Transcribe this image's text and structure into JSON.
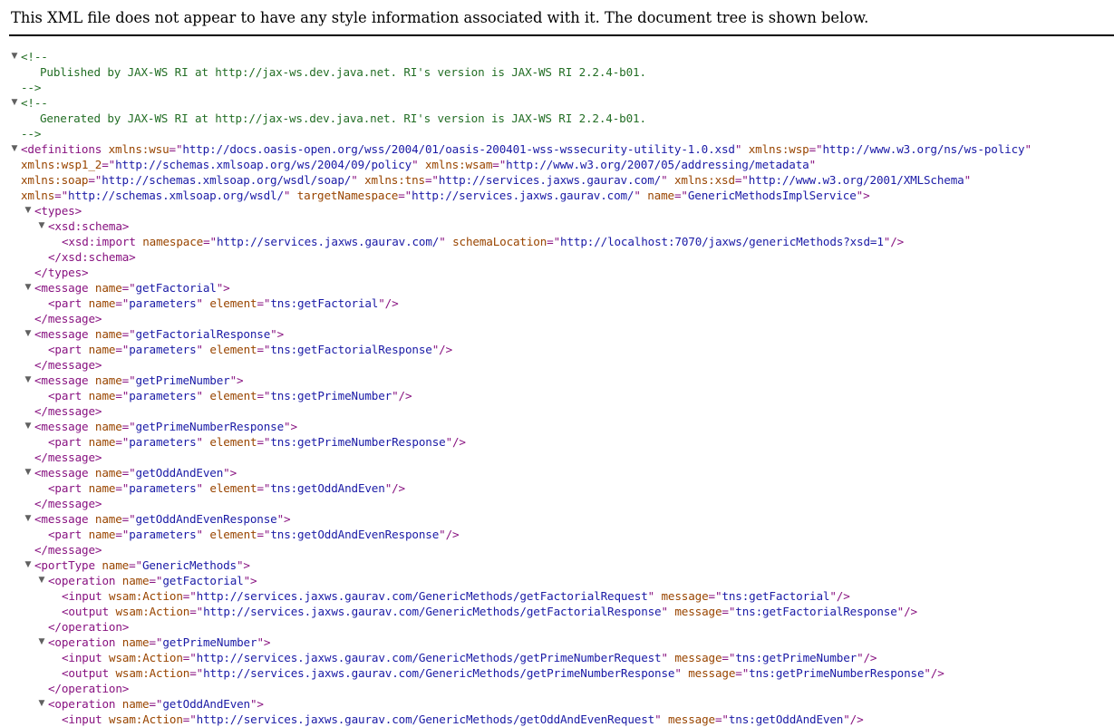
{
  "header": {
    "message": "This XML file does not appear to have any style information associated with it. The document tree is shown below."
  },
  "icons": {
    "toggle": "collapse-triangle-icon",
    "toggle_glyph": "▼"
  },
  "colors": {
    "tag": "#881280",
    "attribute_name": "#994500",
    "attribute_value": "#1a1aa6",
    "comment": "#236e25",
    "toggle": "#606060"
  },
  "lines": [
    {
      "d": 0,
      "toggle": true,
      "tokens": [
        [
          "c",
          "<!--"
        ]
      ]
    },
    {
      "d": 0,
      "x": 44,
      "tokens": [
        [
          "c",
          "Published by JAX-WS RI at http://jax-ws.dev.java.net. RI's version is JAX-WS RI 2.2.4-b01."
        ]
      ]
    },
    {
      "d": 0,
      "tokens": [
        [
          "c",
          "-->"
        ]
      ]
    },
    {
      "d": 0,
      "toggle": true,
      "tokens": [
        [
          "c",
          "<!--"
        ]
      ]
    },
    {
      "d": 0,
      "x": 44,
      "tokens": [
        [
          "c",
          "Generated by JAX-WS RI at http://jax-ws.dev.java.net. RI's version is JAX-WS RI 2.2.4-b01."
        ]
      ]
    },
    {
      "d": 0,
      "tokens": [
        [
          "c",
          "-->"
        ]
      ]
    },
    {
      "d": 0,
      "toggle": true,
      "tokens": [
        [
          "t",
          "<definitions"
        ],
        [
          "s",
          " "
        ],
        [
          "an",
          "xmlns:wsu"
        ],
        [
          "t",
          "=\""
        ],
        [
          "av",
          "http://docs.oasis-open.org/wss/2004/01/oasis-200401-wss-wssecurity-utility-1.0.xsd"
        ],
        [
          "t",
          "\""
        ],
        [
          "s",
          " "
        ],
        [
          "an",
          "xmlns:wsp"
        ],
        [
          "t",
          "=\""
        ],
        [
          "av",
          "http://www.w3.org/ns/ws-policy"
        ],
        [
          "t",
          "\""
        ]
      ]
    },
    {
      "d": 0,
      "tokens": [
        [
          "an",
          "xmlns:wsp1_2"
        ],
        [
          "t",
          "=\""
        ],
        [
          "av",
          "http://schemas.xmlsoap.org/ws/2004/09/policy"
        ],
        [
          "t",
          "\""
        ],
        [
          "s",
          " "
        ],
        [
          "an",
          "xmlns:wsam"
        ],
        [
          "t",
          "=\""
        ],
        [
          "av",
          "http://www.w3.org/2007/05/addressing/metadata"
        ],
        [
          "t",
          "\""
        ]
      ]
    },
    {
      "d": 0,
      "tokens": [
        [
          "an",
          "xmlns:soap"
        ],
        [
          "t",
          "=\""
        ],
        [
          "av",
          "http://schemas.xmlsoap.org/wsdl/soap/"
        ],
        [
          "t",
          "\""
        ],
        [
          "s",
          " "
        ],
        [
          "an",
          "xmlns:tns"
        ],
        [
          "t",
          "=\""
        ],
        [
          "av",
          "http://services.jaxws.gaurav.com/"
        ],
        [
          "t",
          "\""
        ],
        [
          "s",
          " "
        ],
        [
          "an",
          "xmlns:xsd"
        ],
        [
          "t",
          "=\""
        ],
        [
          "av",
          "http://www.w3.org/2001/XMLSchema"
        ],
        [
          "t",
          "\""
        ]
      ]
    },
    {
      "d": 0,
      "tokens": [
        [
          "an",
          "xmlns"
        ],
        [
          "t",
          "=\""
        ],
        [
          "av",
          "http://schemas.xmlsoap.org/wsdl/"
        ],
        [
          "t",
          "\""
        ],
        [
          "s",
          " "
        ],
        [
          "an",
          "targetNamespace"
        ],
        [
          "t",
          "=\""
        ],
        [
          "av",
          "http://services.jaxws.gaurav.com/"
        ],
        [
          "t",
          "\""
        ],
        [
          "s",
          " "
        ],
        [
          "an",
          "name"
        ],
        [
          "t",
          "=\""
        ],
        [
          "av",
          "GenericMethodsImplService"
        ],
        [
          "t",
          "\">"
        ]
      ]
    },
    {
      "d": 1,
      "toggle": true,
      "tokens": [
        [
          "t",
          "<types>"
        ]
      ]
    },
    {
      "d": 2,
      "toggle": true,
      "tokens": [
        [
          "t",
          "<xsd:schema>"
        ]
      ]
    },
    {
      "d": 3,
      "tokens": [
        [
          "t",
          "<xsd:import"
        ],
        [
          "s",
          " "
        ],
        [
          "an",
          "namespace"
        ],
        [
          "t",
          "=\""
        ],
        [
          "av",
          "http://services.jaxws.gaurav.com/"
        ],
        [
          "t",
          "\""
        ],
        [
          "s",
          " "
        ],
        [
          "an",
          "schemaLocation"
        ],
        [
          "t",
          "=\""
        ],
        [
          "av",
          "http://localhost:7070/jaxws/genericMethods?xsd=1"
        ],
        [
          "t",
          "\"/>"
        ]
      ]
    },
    {
      "d": 2,
      "tokens": [
        [
          "t",
          "</xsd:schema>"
        ]
      ]
    },
    {
      "d": 1,
      "tokens": [
        [
          "t",
          "</types>"
        ]
      ]
    },
    {
      "d": 1,
      "toggle": true,
      "tokens": [
        [
          "t",
          "<message"
        ],
        [
          "s",
          " "
        ],
        [
          "an",
          "name"
        ],
        [
          "t",
          "=\""
        ],
        [
          "av",
          "getFactorial"
        ],
        [
          "t",
          "\">"
        ]
      ]
    },
    {
      "d": 2,
      "tokens": [
        [
          "t",
          "<part"
        ],
        [
          "s",
          " "
        ],
        [
          "an",
          "name"
        ],
        [
          "t",
          "=\""
        ],
        [
          "av",
          "parameters"
        ],
        [
          "t",
          "\""
        ],
        [
          "s",
          " "
        ],
        [
          "an",
          "element"
        ],
        [
          "t",
          "=\""
        ],
        [
          "av",
          "tns:getFactorial"
        ],
        [
          "t",
          "\"/>"
        ]
      ]
    },
    {
      "d": 1,
      "tokens": [
        [
          "t",
          "</message>"
        ]
      ]
    },
    {
      "d": 1,
      "toggle": true,
      "tokens": [
        [
          "t",
          "<message"
        ],
        [
          "s",
          " "
        ],
        [
          "an",
          "name"
        ],
        [
          "t",
          "=\""
        ],
        [
          "av",
          "getFactorialResponse"
        ],
        [
          "t",
          "\">"
        ]
      ]
    },
    {
      "d": 2,
      "tokens": [
        [
          "t",
          "<part"
        ],
        [
          "s",
          " "
        ],
        [
          "an",
          "name"
        ],
        [
          "t",
          "=\""
        ],
        [
          "av",
          "parameters"
        ],
        [
          "t",
          "\""
        ],
        [
          "s",
          " "
        ],
        [
          "an",
          "element"
        ],
        [
          "t",
          "=\""
        ],
        [
          "av",
          "tns:getFactorialResponse"
        ],
        [
          "t",
          "\"/>"
        ]
      ]
    },
    {
      "d": 1,
      "tokens": [
        [
          "t",
          "</message>"
        ]
      ]
    },
    {
      "d": 1,
      "toggle": true,
      "tokens": [
        [
          "t",
          "<message"
        ],
        [
          "s",
          " "
        ],
        [
          "an",
          "name"
        ],
        [
          "t",
          "=\""
        ],
        [
          "av",
          "getPrimeNumber"
        ],
        [
          "t",
          "\">"
        ]
      ]
    },
    {
      "d": 2,
      "tokens": [
        [
          "t",
          "<part"
        ],
        [
          "s",
          " "
        ],
        [
          "an",
          "name"
        ],
        [
          "t",
          "=\""
        ],
        [
          "av",
          "parameters"
        ],
        [
          "t",
          "\""
        ],
        [
          "s",
          " "
        ],
        [
          "an",
          "element"
        ],
        [
          "t",
          "=\""
        ],
        [
          "av",
          "tns:getPrimeNumber"
        ],
        [
          "t",
          "\"/>"
        ]
      ]
    },
    {
      "d": 1,
      "tokens": [
        [
          "t",
          "</message>"
        ]
      ]
    },
    {
      "d": 1,
      "toggle": true,
      "tokens": [
        [
          "t",
          "<message"
        ],
        [
          "s",
          " "
        ],
        [
          "an",
          "name"
        ],
        [
          "t",
          "=\""
        ],
        [
          "av",
          "getPrimeNumberResponse"
        ],
        [
          "t",
          "\">"
        ]
      ]
    },
    {
      "d": 2,
      "tokens": [
        [
          "t",
          "<part"
        ],
        [
          "s",
          " "
        ],
        [
          "an",
          "name"
        ],
        [
          "t",
          "=\""
        ],
        [
          "av",
          "parameters"
        ],
        [
          "t",
          "\""
        ],
        [
          "s",
          " "
        ],
        [
          "an",
          "element"
        ],
        [
          "t",
          "=\""
        ],
        [
          "av",
          "tns:getPrimeNumberResponse"
        ],
        [
          "t",
          "\"/>"
        ]
      ]
    },
    {
      "d": 1,
      "tokens": [
        [
          "t",
          "</message>"
        ]
      ]
    },
    {
      "d": 1,
      "toggle": true,
      "tokens": [
        [
          "t",
          "<message"
        ],
        [
          "s",
          " "
        ],
        [
          "an",
          "name"
        ],
        [
          "t",
          "=\""
        ],
        [
          "av",
          "getOddAndEven"
        ],
        [
          "t",
          "\">"
        ]
      ]
    },
    {
      "d": 2,
      "tokens": [
        [
          "t",
          "<part"
        ],
        [
          "s",
          " "
        ],
        [
          "an",
          "name"
        ],
        [
          "t",
          "=\""
        ],
        [
          "av",
          "parameters"
        ],
        [
          "t",
          "\""
        ],
        [
          "s",
          " "
        ],
        [
          "an",
          "element"
        ],
        [
          "t",
          "=\""
        ],
        [
          "av",
          "tns:getOddAndEven"
        ],
        [
          "t",
          "\"/>"
        ]
      ]
    },
    {
      "d": 1,
      "tokens": [
        [
          "t",
          "</message>"
        ]
      ]
    },
    {
      "d": 1,
      "toggle": true,
      "tokens": [
        [
          "t",
          "<message"
        ],
        [
          "s",
          " "
        ],
        [
          "an",
          "name"
        ],
        [
          "t",
          "=\""
        ],
        [
          "av",
          "getOddAndEvenResponse"
        ],
        [
          "t",
          "\">"
        ]
      ]
    },
    {
      "d": 2,
      "tokens": [
        [
          "t",
          "<part"
        ],
        [
          "s",
          " "
        ],
        [
          "an",
          "name"
        ],
        [
          "t",
          "=\""
        ],
        [
          "av",
          "parameters"
        ],
        [
          "t",
          "\""
        ],
        [
          "s",
          " "
        ],
        [
          "an",
          "element"
        ],
        [
          "t",
          "=\""
        ],
        [
          "av",
          "tns:getOddAndEvenResponse"
        ],
        [
          "t",
          "\"/>"
        ]
      ]
    },
    {
      "d": 1,
      "tokens": [
        [
          "t",
          "</message>"
        ]
      ]
    },
    {
      "d": 1,
      "toggle": true,
      "tokens": [
        [
          "t",
          "<portType"
        ],
        [
          "s",
          " "
        ],
        [
          "an",
          "name"
        ],
        [
          "t",
          "=\""
        ],
        [
          "av",
          "GenericMethods"
        ],
        [
          "t",
          "\">"
        ]
      ]
    },
    {
      "d": 2,
      "toggle": true,
      "tokens": [
        [
          "t",
          "<operation"
        ],
        [
          "s",
          " "
        ],
        [
          "an",
          "name"
        ],
        [
          "t",
          "=\""
        ],
        [
          "av",
          "getFactorial"
        ],
        [
          "t",
          "\">"
        ]
      ]
    },
    {
      "d": 3,
      "tokens": [
        [
          "t",
          "<input"
        ],
        [
          "s",
          " "
        ],
        [
          "an",
          "wsam:Action"
        ],
        [
          "t",
          "=\""
        ],
        [
          "av",
          "http://services.jaxws.gaurav.com/GenericMethods/getFactorialRequest"
        ],
        [
          "t",
          "\""
        ],
        [
          "s",
          " "
        ],
        [
          "an",
          "message"
        ],
        [
          "t",
          "=\""
        ],
        [
          "av",
          "tns:getFactorial"
        ],
        [
          "t",
          "\"/>"
        ]
      ]
    },
    {
      "d": 3,
      "tokens": [
        [
          "t",
          "<output"
        ],
        [
          "s",
          " "
        ],
        [
          "an",
          "wsam:Action"
        ],
        [
          "t",
          "=\""
        ],
        [
          "av",
          "http://services.jaxws.gaurav.com/GenericMethods/getFactorialResponse"
        ],
        [
          "t",
          "\""
        ],
        [
          "s",
          " "
        ],
        [
          "an",
          "message"
        ],
        [
          "t",
          "=\""
        ],
        [
          "av",
          "tns:getFactorialResponse"
        ],
        [
          "t",
          "\"/>"
        ]
      ]
    },
    {
      "d": 2,
      "tokens": [
        [
          "t",
          "</operation>"
        ]
      ]
    },
    {
      "d": 2,
      "toggle": true,
      "tokens": [
        [
          "t",
          "<operation"
        ],
        [
          "s",
          " "
        ],
        [
          "an",
          "name"
        ],
        [
          "t",
          "=\""
        ],
        [
          "av",
          "getPrimeNumber"
        ],
        [
          "t",
          "\">"
        ]
      ]
    },
    {
      "d": 3,
      "tokens": [
        [
          "t",
          "<input"
        ],
        [
          "s",
          " "
        ],
        [
          "an",
          "wsam:Action"
        ],
        [
          "t",
          "=\""
        ],
        [
          "av",
          "http://services.jaxws.gaurav.com/GenericMethods/getPrimeNumberRequest"
        ],
        [
          "t",
          "\""
        ],
        [
          "s",
          " "
        ],
        [
          "an",
          "message"
        ],
        [
          "t",
          "=\""
        ],
        [
          "av",
          "tns:getPrimeNumber"
        ],
        [
          "t",
          "\"/>"
        ]
      ]
    },
    {
      "d": 3,
      "tokens": [
        [
          "t",
          "<output"
        ],
        [
          "s",
          " "
        ],
        [
          "an",
          "wsam:Action"
        ],
        [
          "t",
          "=\""
        ],
        [
          "av",
          "http://services.jaxws.gaurav.com/GenericMethods/getPrimeNumberResponse"
        ],
        [
          "t",
          "\""
        ],
        [
          "s",
          " "
        ],
        [
          "an",
          "message"
        ],
        [
          "t",
          "=\""
        ],
        [
          "av",
          "tns:getPrimeNumberResponse"
        ],
        [
          "t",
          "\"/>"
        ]
      ]
    },
    {
      "d": 2,
      "tokens": [
        [
          "t",
          "</operation>"
        ]
      ]
    },
    {
      "d": 2,
      "toggle": true,
      "tokens": [
        [
          "t",
          "<operation"
        ],
        [
          "s",
          " "
        ],
        [
          "an",
          "name"
        ],
        [
          "t",
          "=\""
        ],
        [
          "av",
          "getOddAndEven"
        ],
        [
          "t",
          "\">"
        ]
      ]
    },
    {
      "d": 3,
      "tokens": [
        [
          "t",
          "<input"
        ],
        [
          "s",
          " "
        ],
        [
          "an",
          "wsam:Action"
        ],
        [
          "t",
          "=\""
        ],
        [
          "av",
          "http://services.jaxws.gaurav.com/GenericMethods/getOddAndEvenRequest"
        ],
        [
          "t",
          "\""
        ],
        [
          "s",
          " "
        ],
        [
          "an",
          "message"
        ],
        [
          "t",
          "=\""
        ],
        [
          "av",
          "tns:getOddAndEven"
        ],
        [
          "t",
          "\"/>"
        ]
      ]
    }
  ]
}
